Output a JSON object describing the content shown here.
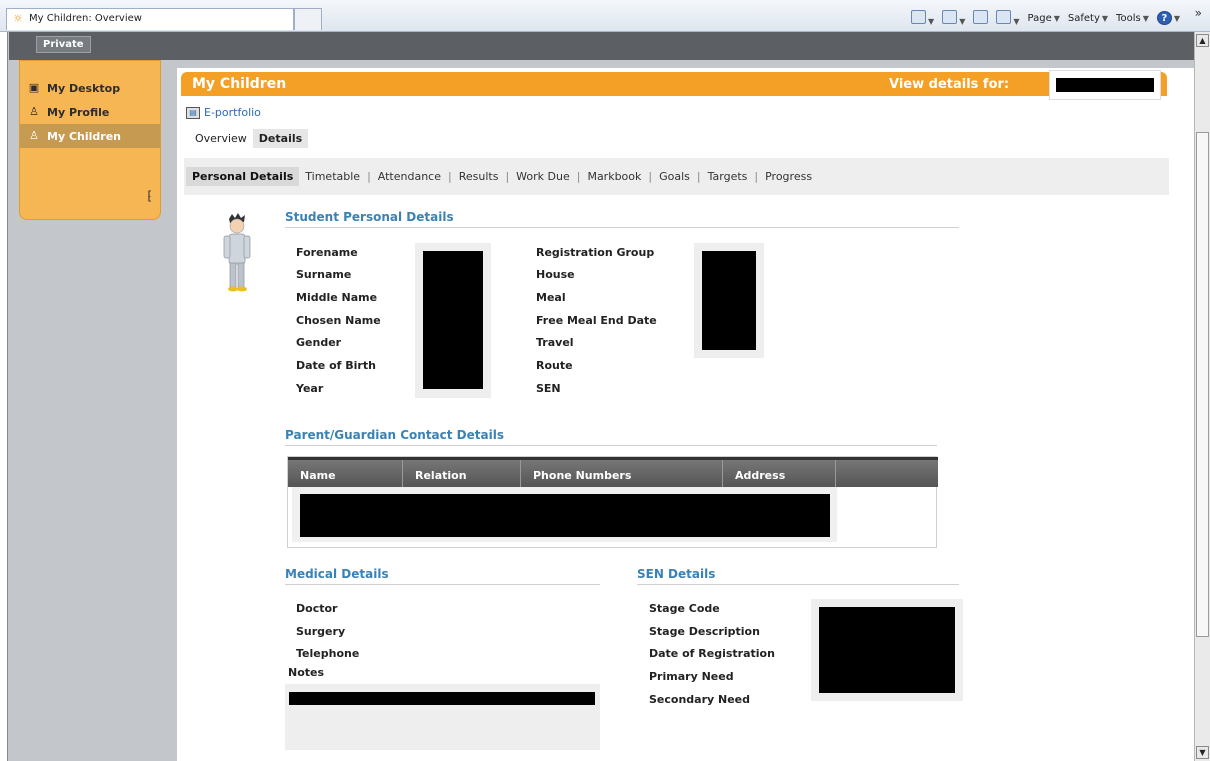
{
  "browser": {
    "tab_title": "My Children: Overview",
    "commands": {
      "page": "Page",
      "safety": "Safety",
      "tools": "Tools"
    },
    "overflow": "»"
  },
  "topbar": {
    "private_label": "Private"
  },
  "sidebar": {
    "items": [
      {
        "label": "My Desktop",
        "icon": "desktop-icon"
      },
      {
        "label": "My Profile",
        "icon": "profile-icon"
      },
      {
        "label": "My Children",
        "icon": "children-icon",
        "active": true
      }
    ],
    "collapse_glyph": "⁅"
  },
  "header": {
    "title": "My Children",
    "view_details_label": "View details for:"
  },
  "eportfolio_link": "E-portfolio",
  "subtabs": [
    {
      "label": "Overview",
      "active": false
    },
    {
      "label": "Details",
      "active": true
    }
  ],
  "tabs": [
    {
      "label": "Personal Details",
      "active": true
    },
    {
      "label": "Timetable"
    },
    {
      "label": "Attendance"
    },
    {
      "label": "Results"
    },
    {
      "label": "Work Due"
    },
    {
      "label": "Markbook"
    },
    {
      "label": "Goals"
    },
    {
      "label": "Targets"
    },
    {
      "label": "Progress"
    }
  ],
  "personal": {
    "title": "Student Personal Details",
    "left_labels": [
      "Forename",
      "Surname",
      "Middle Name",
      "Chosen Name",
      "Gender",
      "Date of Birth",
      "Year"
    ],
    "right_labels": [
      "Registration Group",
      "House",
      "Meal",
      "Free Meal End Date",
      "Travel",
      "Route",
      "SEN"
    ]
  },
  "contacts": {
    "title": "Parent/Guardian Contact Details",
    "columns": [
      "Name",
      "Relation",
      "Phone Numbers",
      "Address"
    ]
  },
  "medical": {
    "title": "Medical Details",
    "labels": [
      "Doctor",
      "Surgery",
      "Telephone"
    ],
    "notes_label": "Notes"
  },
  "sen": {
    "title": "SEN Details",
    "labels": [
      "Stage Code",
      "Stage Description",
      "Date of Registration",
      "Primary Need",
      "Secondary Need"
    ]
  },
  "colors": {
    "accent": "#f49f25",
    "sidebar": "#f6b654",
    "section_title": "#3a82b5"
  }
}
